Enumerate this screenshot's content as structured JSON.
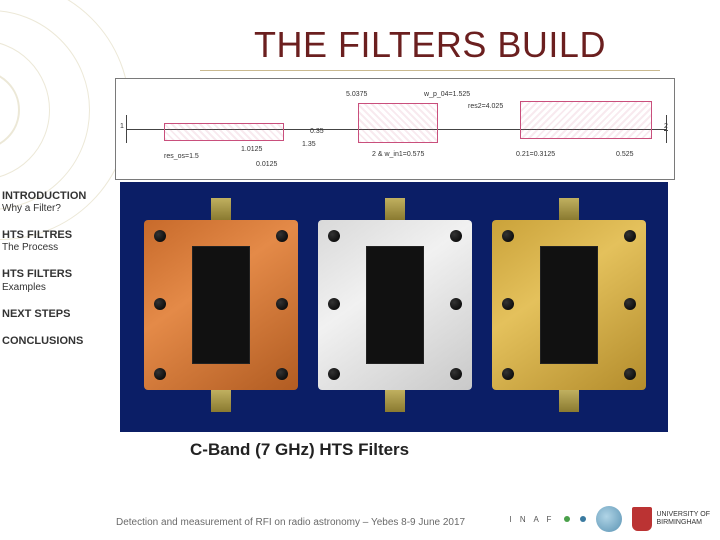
{
  "title": "THE FILTERS BUILD",
  "sidebar": {
    "items": [
      {
        "head": "INTRODUCTION",
        "sub": "Why a Filter?"
      },
      {
        "head": "HTS FILTRES",
        "sub": "The Process"
      },
      {
        "head": "HTS FILTERS",
        "sub": "Examples"
      },
      {
        "head": "NEXT STEPS",
        "sub": ""
      },
      {
        "head": "CONCLUSIONS",
        "sub": ""
      }
    ]
  },
  "schematic": {
    "labels": {
      "l1": "res_os=1.5",
      "l2": "1.0125",
      "l3": "0.0125",
      "l4": "1.35",
      "l5": "0.35",
      "l6": "5.0375",
      "l7": "w_p_04=1.525",
      "l8": "2 & w_in1=0.575",
      "l9": "res2=4.025",
      "l10": "0.21=0.3125",
      "l11": "0.525",
      "p1": "1",
      "p2": "2"
    }
  },
  "caption": "C-Band (7 GHz) HTS Filters",
  "footer": "Detection and measurement of RFI on radio astronomy – Yebes 8-9 June 2017",
  "logos": {
    "inaf": "I N A F",
    "uob_line1": "UNIVERSITY OF",
    "uob_line2": "BIRMINGHAM"
  }
}
